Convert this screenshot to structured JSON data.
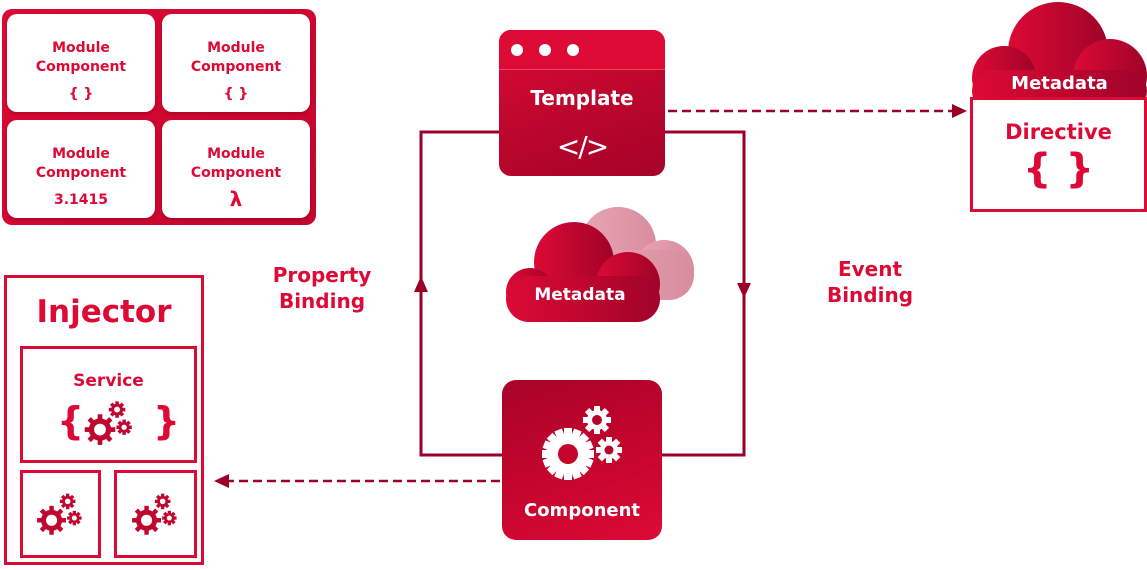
{
  "module_grid": {
    "cards": [
      {
        "title_line1": "Module",
        "title_line2": "Component",
        "symbol": "{ }"
      },
      {
        "title_line1": "Module",
        "title_line2": "Component",
        "symbol": "{ }"
      },
      {
        "title_line1": "Module",
        "title_line2": "Component",
        "symbol": "3.1415"
      },
      {
        "title_line1": "Module",
        "title_line2": "Component",
        "symbol": "λ"
      }
    ]
  },
  "template": {
    "title": "Template",
    "code_symbol": "</>"
  },
  "metadata_center": {
    "label": "Metadata"
  },
  "component": {
    "label": "Component"
  },
  "property_binding": {
    "line1": "Property",
    "line2": "Binding"
  },
  "event_binding": {
    "line1": "Event",
    "line2": "Binding"
  },
  "directive": {
    "cloud_label": "Metadata",
    "title": "Directive",
    "symbol": "{ }"
  },
  "injector": {
    "title": "Injector",
    "service": {
      "title": "Service",
      "brace_open": "{",
      "brace_close": "}"
    }
  },
  "colors": {
    "primary_red": "#dc0a35",
    "dark_red": "#a60329",
    "arrow": "#9b0028",
    "light_cloud": "#dc97a6"
  }
}
